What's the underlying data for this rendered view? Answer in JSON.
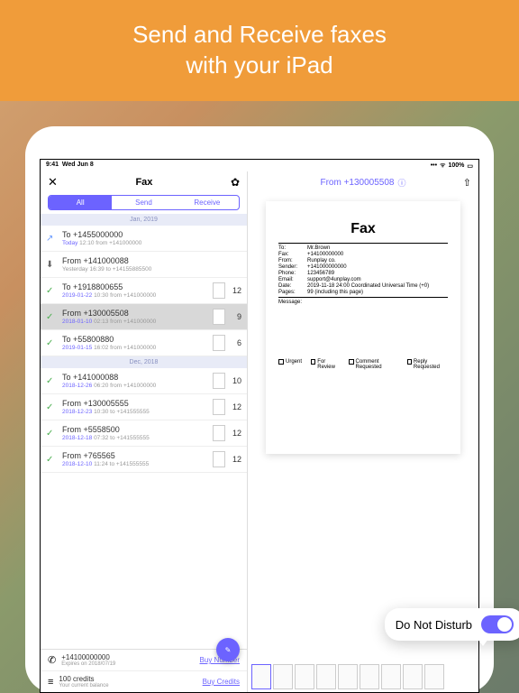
{
  "promo": {
    "line1": "Send and Receive faxes",
    "line2": "with your iPad"
  },
  "status": {
    "time": "9:41",
    "date": "Wed Jun 8",
    "wifi": "100%"
  },
  "header": {
    "title": "Fax"
  },
  "tabs": {
    "all": "All",
    "send": "Send",
    "receive": "Receive"
  },
  "sections": {
    "s1": "Jan, 2019",
    "s2": "Dec, 2018"
  },
  "items": [
    {
      "addr": "To +1455000000",
      "date": "Today",
      "time": "12:10",
      "detail": "from +141000000",
      "count": ""
    },
    {
      "addr": "From +141000088",
      "date": "Yesterday",
      "time": "16:39",
      "detail": "to +14155885500",
      "count": ""
    },
    {
      "addr": "To +1918800655",
      "date": "2019-01-22",
      "time": "10:30",
      "detail": "from +141000000",
      "count": "12"
    },
    {
      "addr": "From +130005508",
      "date": "2018-01-10",
      "time": "02:13",
      "detail": "from +141000000",
      "count": "9"
    },
    {
      "addr": "To +55800880",
      "date": "2019-01-15",
      "time": "16:02",
      "detail": "from +141000000",
      "count": "6"
    },
    {
      "addr": "To +141000088",
      "date": "2018-12-26",
      "time": "06:20",
      "detail": "from +141000000",
      "count": "10"
    },
    {
      "addr": "From +130005555",
      "date": "2018-12-23",
      "time": "10:30",
      "detail": "to +141555555",
      "count": "12"
    },
    {
      "addr": "From +5558500",
      "date": "2018-12-18",
      "time": "07:32",
      "detail": "to +141555555",
      "count": "12"
    },
    {
      "addr": "From +765565",
      "date": "2018-12-10",
      "time": "11:24",
      "detail": "to +141555555",
      "count": "12"
    }
  ],
  "footer": {
    "number": "+14100000000",
    "numberSub": "Expires on 2018/07/19",
    "buyNumber": "Buy Number",
    "credits": "100 credits",
    "creditsSub": "Your current balance",
    "buyCredits": "Buy Credits"
  },
  "preview": {
    "title": "From +130005508"
  },
  "faxdoc": {
    "heading": "Fax",
    "to": "Mr.Brown",
    "fax": "+14100000000",
    "from": "Runplay co.",
    "sender": "+141000000000",
    "phone": "123456789",
    "email": "support@4unplay.com",
    "dateline": "2019-11-18 24:00 Coordinated Universal Time (+0)",
    "pages": "99 (including this page)",
    "labels": {
      "to": "To:",
      "fax": "Fax:",
      "from": "From:",
      "sender": "Sender:",
      "phone": "Phone:",
      "email": "Email:",
      "date": "Date:",
      "pages": "Pages:",
      "message": "Message:"
    },
    "cb": {
      "urgent": "Urgent",
      "review": "For Review",
      "comment": "Comment Requested",
      "reply": "Reply Requested"
    }
  },
  "dnd": {
    "label": "Do Not Disturb"
  }
}
